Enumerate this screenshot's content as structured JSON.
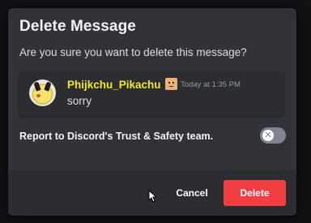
{
  "dialog": {
    "title": "Delete Message",
    "prompt": "Are you sure you want to delete this message?"
  },
  "message": {
    "author": "Phijkchu_Pikachu",
    "author_color": "#f0e626",
    "timestamp": "Today at 1:35 PM",
    "content": "sorry",
    "avatar_icon": "pikachu-avatar",
    "badge_icon": "face-badge-icon"
  },
  "report": {
    "label": "Report to Discord's Trust & Safety team.",
    "toggle_state": "off",
    "toggle_icon_glyph": "✕"
  },
  "buttons": {
    "cancel_label": "Cancel",
    "delete_label": "Delete",
    "delete_color": "#f23f42"
  }
}
